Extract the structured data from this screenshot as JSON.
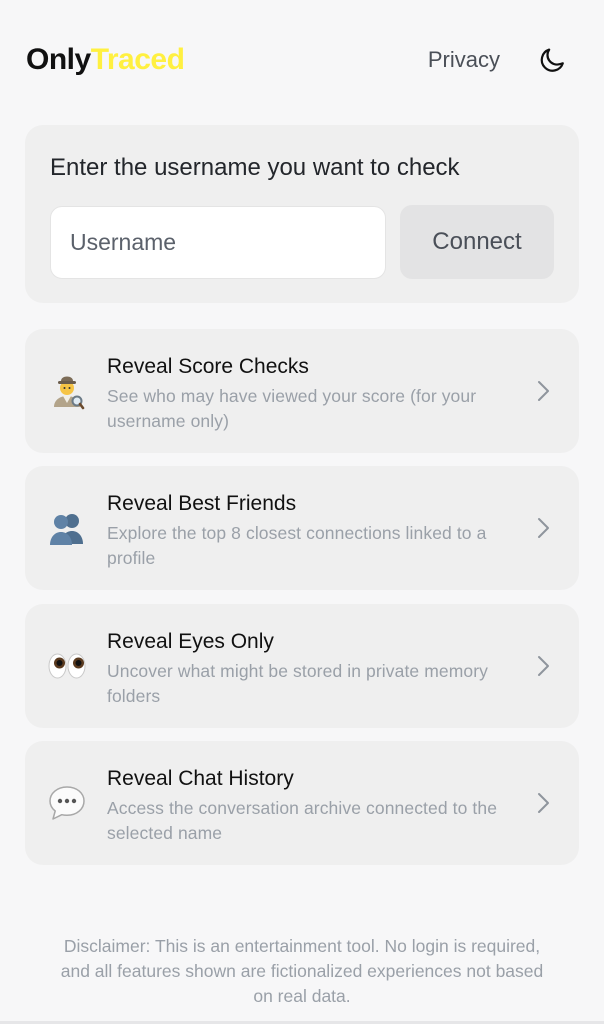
{
  "header": {
    "logo_part1": "Only",
    "logo_part2": "Traced",
    "privacy_label": "Privacy",
    "theme_icon": "moon-icon"
  },
  "search": {
    "title": "Enter the username you want to check",
    "placeholder": "Username",
    "value": "",
    "button_label": "Connect"
  },
  "features": [
    {
      "icon": "detective-icon",
      "title": "Reveal Score Checks",
      "description": "See who may have viewed your score (for your username only)"
    },
    {
      "icon": "people-icon",
      "title": "Reveal Best Friends",
      "description": "Explore the top 8 closest connections linked to a profile"
    },
    {
      "icon": "eyes-icon",
      "title": "Reveal Eyes Only",
      "description": "Uncover what might be stored in private memory folders"
    },
    {
      "icon": "speech-bubble-icon",
      "title": "Reveal Chat History",
      "description": "Access the conversation archive connected to the selected name"
    }
  ],
  "disclaimer": "Disclaimer: This is an entertainment tool. No login is required, and all features shown are fictionalized experiences not based on real data.",
  "colors": {
    "logo_accent": "#fff040",
    "card_bg": "#efefef",
    "muted_text": "#9aa0a8"
  }
}
